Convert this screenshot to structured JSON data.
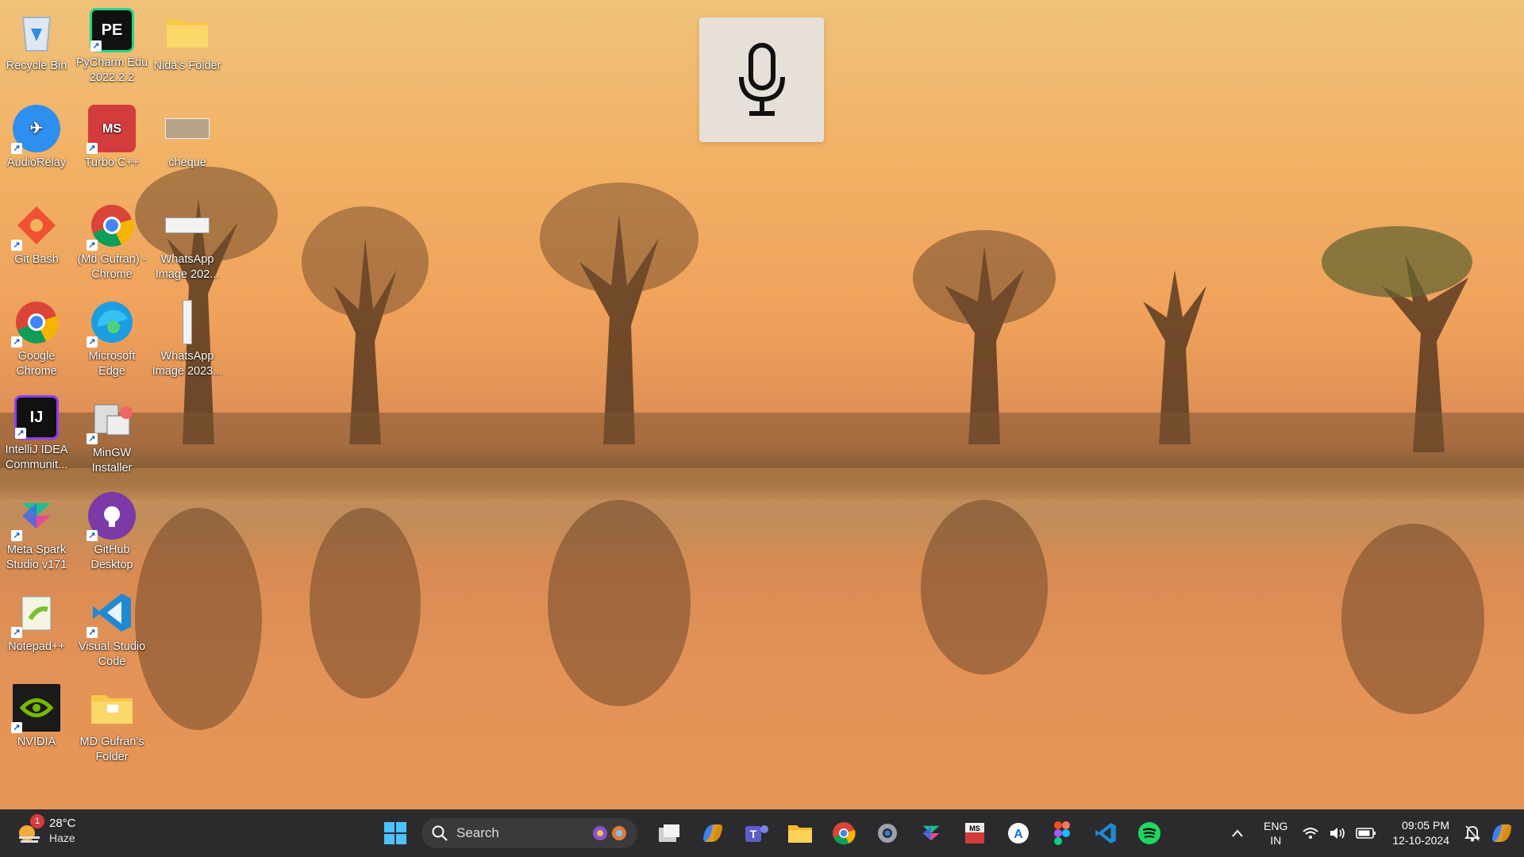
{
  "desktop": {
    "icons": [
      {
        "label": "Recycle Bin"
      },
      {
        "label": "PyCharm Edu 2022.2.2"
      },
      {
        "label": "Nida's Folder"
      },
      {
        "label": "AudioRelay"
      },
      {
        "label": "Turbo C++"
      },
      {
        "label": "cheque"
      },
      {
        "label": "Git Bash"
      },
      {
        "label": "(Md Gufran) - Chrome"
      },
      {
        "label": "WhatsApp Image 202..."
      },
      {
        "label": "Google Chrome"
      },
      {
        "label": "Microsoft Edge"
      },
      {
        "label": "WhatsApp Image 2023..."
      },
      {
        "label": "IntelliJ IDEA Communit..."
      },
      {
        "label": "MinGW Installer"
      },
      {
        "label": "Meta Spark Studio v171"
      },
      {
        "label": "GitHub Desktop"
      },
      {
        "label": "Notepad++"
      },
      {
        "label": "Visual Studio Code"
      },
      {
        "label": "NVIDIA"
      },
      {
        "label": "MD Gufran's Folder"
      }
    ],
    "mic_overlay_icon": "microphone-icon"
  },
  "taskbar": {
    "weather": {
      "temp": "28°C",
      "condition": "Haze",
      "badge": "1"
    },
    "search_placeholder": "Search",
    "apps": [
      "start",
      "task-view",
      "copilot",
      "teams",
      "file-explorer",
      "chrome",
      "settings",
      "meta-spark",
      "turbo-c",
      "app-a",
      "figma",
      "vscode",
      "spotify"
    ],
    "lang_top": "ENG",
    "lang_bottom": "IN",
    "time": "09:05 PM",
    "date": "12-10-2024"
  },
  "colors": {
    "taskbar_bg": "#2b2b2e",
    "sky": "#efc27a",
    "sunset": "#ea9a58"
  }
}
